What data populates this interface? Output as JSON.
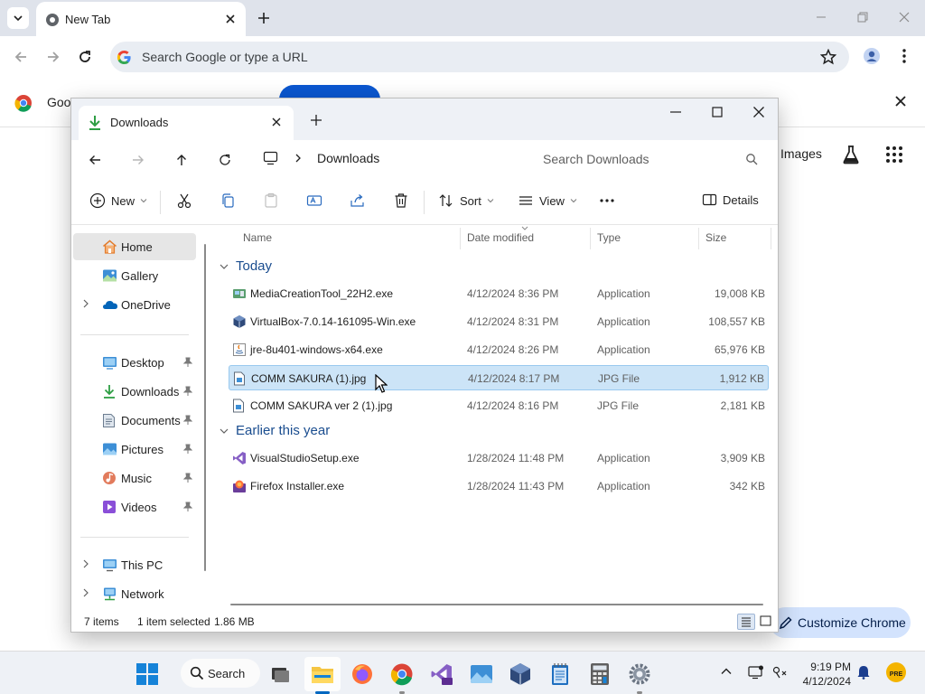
{
  "chrome": {
    "tab_title": "New Tab",
    "omnibox_placeholder": "Search Google or type a URL",
    "infobar_text": "Goo",
    "ntp_images_link": "Images",
    "customize_label": "Customize Chrome"
  },
  "explorer": {
    "tab_title": "Downloads",
    "address_current": "Downloads",
    "search_placeholder": "Search Downloads",
    "commands": {
      "new_label": "New",
      "sort_label": "Sort",
      "view_label": "View",
      "details_label": "Details"
    },
    "sidebar": {
      "items": [
        {
          "label": "Home",
          "icon": "home-icon",
          "selected": true
        },
        {
          "label": "Gallery",
          "icon": "gallery-icon"
        },
        {
          "label": "OneDrive",
          "icon": "onedrive-icon",
          "expandable": true
        },
        {
          "label": "Desktop",
          "icon": "desktop-icon",
          "pinned": true
        },
        {
          "label": "Downloads",
          "icon": "downloads-icon",
          "pinned": true
        },
        {
          "label": "Documents",
          "icon": "documents-icon",
          "pinned": true
        },
        {
          "label": "Pictures",
          "icon": "pictures-icon",
          "pinned": true
        },
        {
          "label": "Music",
          "icon": "music-icon",
          "pinned": true
        },
        {
          "label": "Videos",
          "icon": "videos-icon",
          "pinned": true
        },
        {
          "label": "This PC",
          "icon": "this-pc-icon",
          "expandable": true
        },
        {
          "label": "Network",
          "icon": "network-icon",
          "expandable": true
        }
      ]
    },
    "columns": {
      "name": "Name",
      "date": "Date modified",
      "type": "Type",
      "size": "Size"
    },
    "groups": [
      {
        "label": "Today",
        "files": [
          {
            "name": "MediaCreationTool_22H2.exe",
            "date": "4/12/2024 8:36 PM",
            "type": "Application",
            "size": "19,008 KB",
            "icon": "media-creation-icon"
          },
          {
            "name": "VirtualBox-7.0.14-161095-Win.exe",
            "date": "4/12/2024 8:31 PM",
            "type": "Application",
            "size": "108,557 KB",
            "icon": "virtualbox-icon"
          },
          {
            "name": "jre-8u401-windows-x64.exe",
            "date": "4/12/2024 8:26 PM",
            "type": "Application",
            "size": "65,976 KB",
            "icon": "java-icon"
          },
          {
            "name": "COMM SAKURA  (1).jpg",
            "date": "4/12/2024 8:17 PM",
            "type": "JPG File",
            "size": "1,912 KB",
            "icon": "jpg-file-icon",
            "selected": true
          },
          {
            "name": "COMM SAKURA ver 2 (1).jpg",
            "date": "4/12/2024 8:16 PM",
            "type": "JPG File",
            "size": "2,181 KB",
            "icon": "jpg-file-icon"
          }
        ]
      },
      {
        "label": "Earlier this year",
        "files": [
          {
            "name": "VisualStudioSetup.exe",
            "date": "1/28/2024 11:48 PM",
            "type": "Application",
            "size": "3,909 KB",
            "icon": "visual-studio-icon"
          },
          {
            "name": "Firefox Installer.exe",
            "date": "1/28/2024 11:43 PM",
            "type": "Application",
            "size": "342 KB",
            "icon": "firefox-icon"
          }
        ]
      }
    ],
    "status": {
      "item_count": "7 items",
      "selection": "1 item selected",
      "selection_size": "1.86 MB"
    }
  },
  "taskbar": {
    "search_label": "Search",
    "time": "9:19 PM",
    "date": "4/12/2024",
    "apps": [
      "start-icon",
      "task-view-icon",
      "file-explorer-icon",
      "firefox-icon",
      "chrome-icon",
      "visual-studio-icon",
      "photos-icon",
      "virtualbox-icon",
      "notepad-icon",
      "calculator-icon",
      "settings-icon"
    ]
  },
  "colors": {
    "accent": "#0067c0",
    "selection_bg": "#cce4f7",
    "group_header": "#1a4d8f"
  }
}
